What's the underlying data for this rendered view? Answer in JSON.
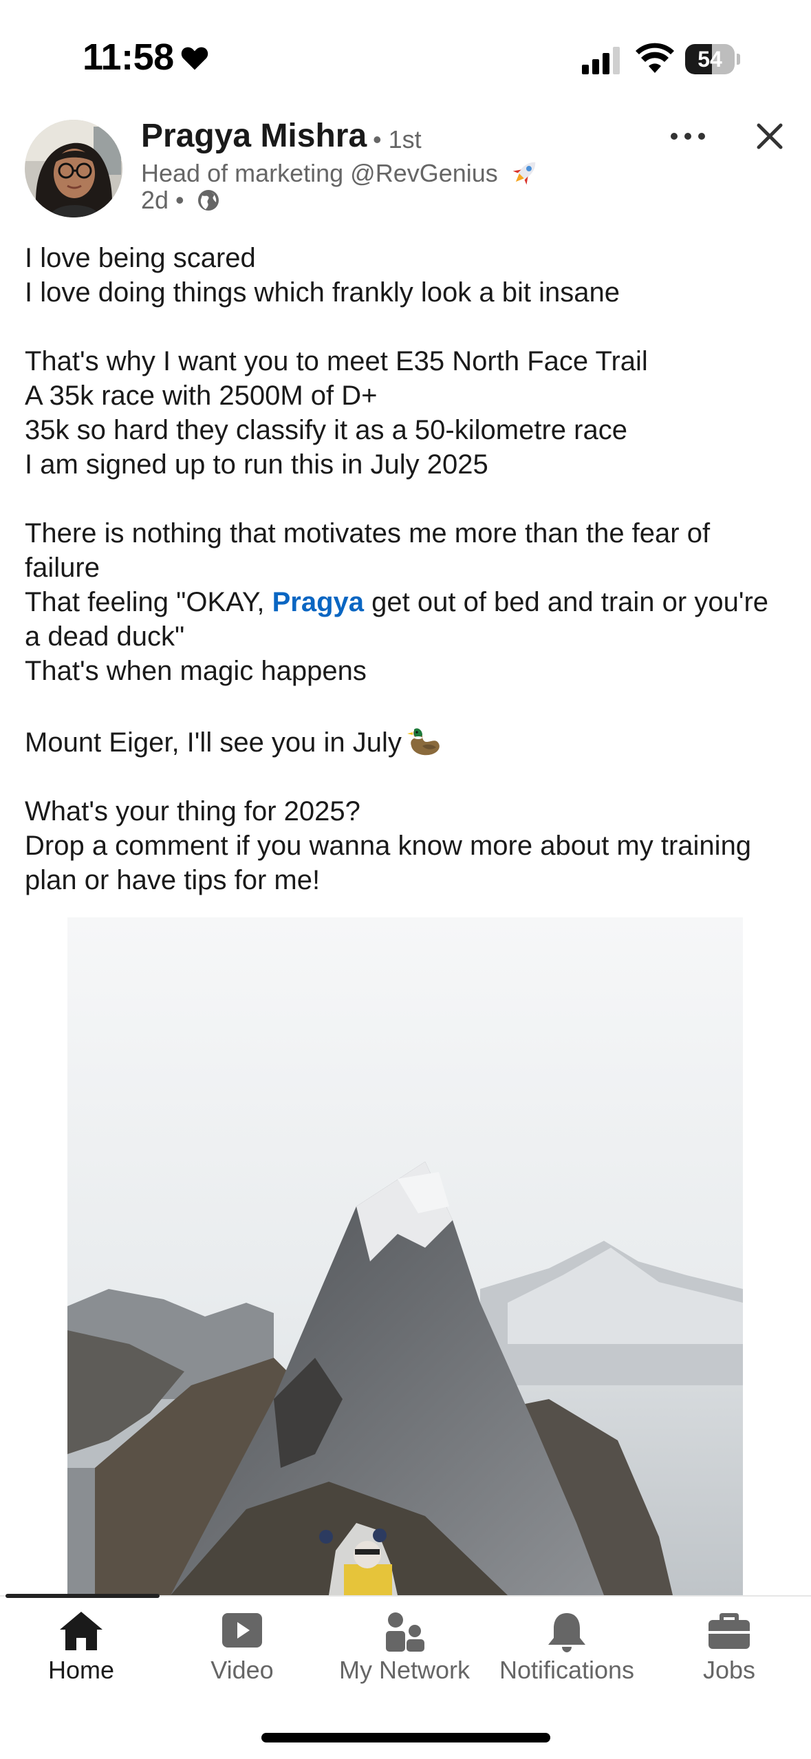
{
  "status_bar": {
    "time": "11:58",
    "battery_level": "54",
    "battery_fraction": 0.54
  },
  "post": {
    "author": {
      "name": "Pragya Mishra",
      "degree": "• 1st",
      "headline": "Head of marketing @RevGenius",
      "timestamp": "2d •"
    },
    "text": {
      "l1": "I love being scared",
      "l2": "I love doing things which frankly look a bit insane",
      "l3": "That's why I want you to meet E35 North Face Trail",
      "l4": "A 35k race with 2500M of D+",
      "l5": "35k so hard they classify it as a 50-kilometre race",
      "l6": "I am signed up to run this in July 2025",
      "l7": "There is nothing that motivates me more than the fear of failure",
      "l8_before": "That feeling \"OKAY, ",
      "l8_mention": "Pragya",
      "l8_after": " get out of bed and train or you're a dead duck\"",
      "l9": "That's when magic happens",
      "l10": "Mount Eiger, I'll see you in July",
      "l11": "What's your thing for 2025?",
      "l12": "Drop a comment if you wanna know more about my training plan or have tips for me!"
    },
    "image_progress_fraction": 0.19
  },
  "bottom_nav": {
    "items": [
      {
        "label": "Home",
        "icon": "home-icon",
        "active": true
      },
      {
        "label": "Video",
        "icon": "video-icon",
        "active": false
      },
      {
        "label": "My Network",
        "icon": "network-icon",
        "active": false
      },
      {
        "label": "Notifications",
        "icon": "bell-icon",
        "active": false
      },
      {
        "label": "Jobs",
        "icon": "briefcase-icon",
        "active": false
      }
    ]
  },
  "colors": {
    "mention": "#0a66c2",
    "text_primary": "#1a1a1a",
    "text_secondary": "#666666"
  }
}
